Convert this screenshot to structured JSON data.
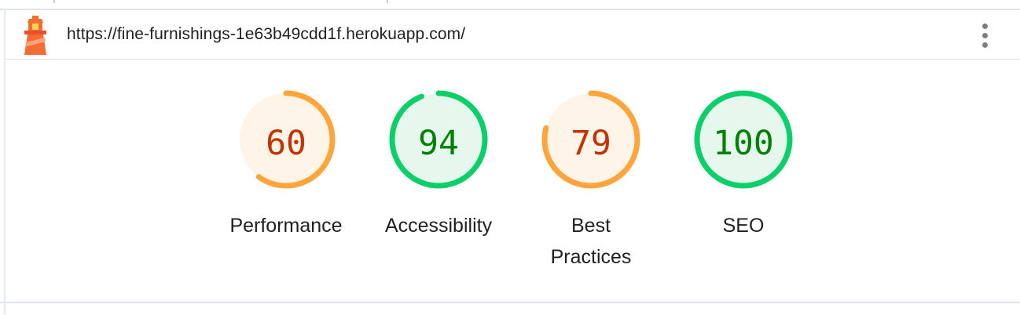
{
  "header": {
    "url": "https://fine-furnishings-1e63b49cdd1f.herokuapp.com/",
    "logo_icon": "lighthouse-icon",
    "menu_icon": "more-vert-icon"
  },
  "colors": {
    "average_arc": "#ffa53c",
    "average_fill": "#fff4e8",
    "average_text": "#c33300",
    "pass_arc": "#0ccf6a",
    "pass_fill": "#e6f8ee",
    "pass_text": "#008000"
  },
  "gauges": [
    {
      "score": "60",
      "label": "Performance",
      "status": "average"
    },
    {
      "score": "94",
      "label": "Accessibility",
      "status": "pass"
    },
    {
      "score": "79",
      "label": "Best Practices",
      "status": "average"
    },
    {
      "score": "100",
      "label": "SEO",
      "status": "pass"
    }
  ]
}
